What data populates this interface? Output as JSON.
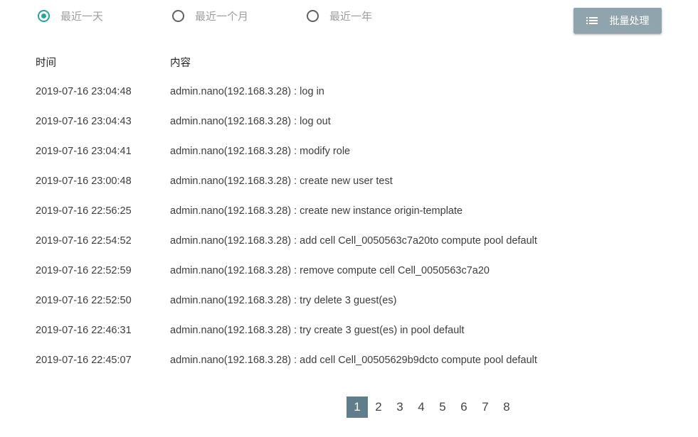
{
  "filters": {
    "options": [
      {
        "label": "最近一天",
        "checked": true
      },
      {
        "label": "最近一个月",
        "checked": false
      },
      {
        "label": "最近一年",
        "checked": false
      }
    ]
  },
  "toolbar": {
    "batch_label": "批量处理",
    "batch_icon": "list-icon"
  },
  "table": {
    "headers": {
      "time": "时间",
      "content": "内容"
    },
    "rows": [
      {
        "time": "2019-07-16 23:04:48",
        "content": "admin.nano(192.168.3.28) : log in"
      },
      {
        "time": "2019-07-16 23:04:43",
        "content": "admin.nano(192.168.3.28) : log out"
      },
      {
        "time": "2019-07-16 23:04:41",
        "content": "admin.nano(192.168.3.28) : modify role"
      },
      {
        "time": "2019-07-16 23:00:48",
        "content": "admin.nano(192.168.3.28) : create new user test"
      },
      {
        "time": "2019-07-16 22:56:25",
        "content": "admin.nano(192.168.3.28) : create new instance origin-template"
      },
      {
        "time": "2019-07-16 22:54:52",
        "content": "admin.nano(192.168.3.28) : add cell Cell_0050563c7a20to compute pool default"
      },
      {
        "time": "2019-07-16 22:52:59",
        "content": "admin.nano(192.168.3.28) : remove compute cell Cell_0050563c7a20"
      },
      {
        "time": "2019-07-16 22:52:50",
        "content": "admin.nano(192.168.3.28) : try delete 3 guest(es)"
      },
      {
        "time": "2019-07-16 22:46:31",
        "content": "admin.nano(192.168.3.28) : try create 3 guest(es) in pool default"
      },
      {
        "time": "2019-07-16 22:45:07",
        "content": "admin.nano(192.168.3.28) : add cell Cell_00505629b9dcto compute pool default"
      }
    ]
  },
  "pagination": {
    "pages": [
      "1",
      "2",
      "3",
      "4",
      "5",
      "6",
      "7",
      "8"
    ],
    "current": "1"
  },
  "colors": {
    "accent": "#26a69a",
    "button_bg": "#90a4ae",
    "active_page_bg": "#607d8b"
  }
}
